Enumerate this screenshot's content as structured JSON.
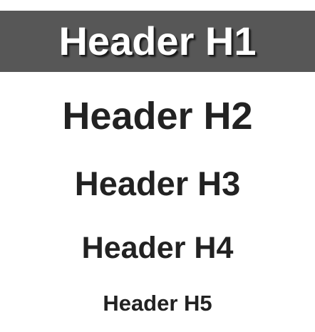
{
  "headers": {
    "h1": "Header H1",
    "h2": "Header H2",
    "h3": "Header H3",
    "h4": "Header H4",
    "h5": "Header H5"
  },
  "colors": {
    "h1_bar_background": "#575757",
    "h1_text": "#ffffff",
    "heading_text": "#222222",
    "page_background": "#ffffff"
  }
}
